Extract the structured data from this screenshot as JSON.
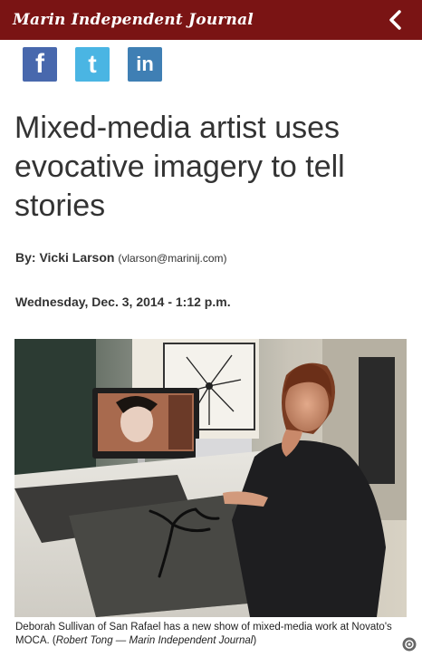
{
  "header": {
    "masthead": "Marin Independent Journal"
  },
  "social": [
    {
      "label": "f",
      "icon": "facebook-icon"
    },
    {
      "label": "t",
      "icon": "twitter-icon"
    },
    {
      "label": "in",
      "icon": "linkedin-icon"
    }
  ],
  "article": {
    "headline": "Mixed-media artist uses evocative imagery to tell stories",
    "byline_label": "By: Vicki Larson",
    "byline_email": "(vlarson@marinij.com)",
    "date": "Wednesday, Dec. 3, 2014 - 1:12 p.m.",
    "caption_text": "Deborah Sullivan of San Rafael has a new show of mixed-media work at Novato's MOCA. (",
    "caption_credit": "Robert Tong — Marin Independent Journal",
    "caption_close": ")"
  },
  "colors": {
    "masthead_bg": "#7a1414",
    "facebook": "#4868ad",
    "twitter": "#4ab5e3",
    "linkedin": "#3f7fb4"
  }
}
